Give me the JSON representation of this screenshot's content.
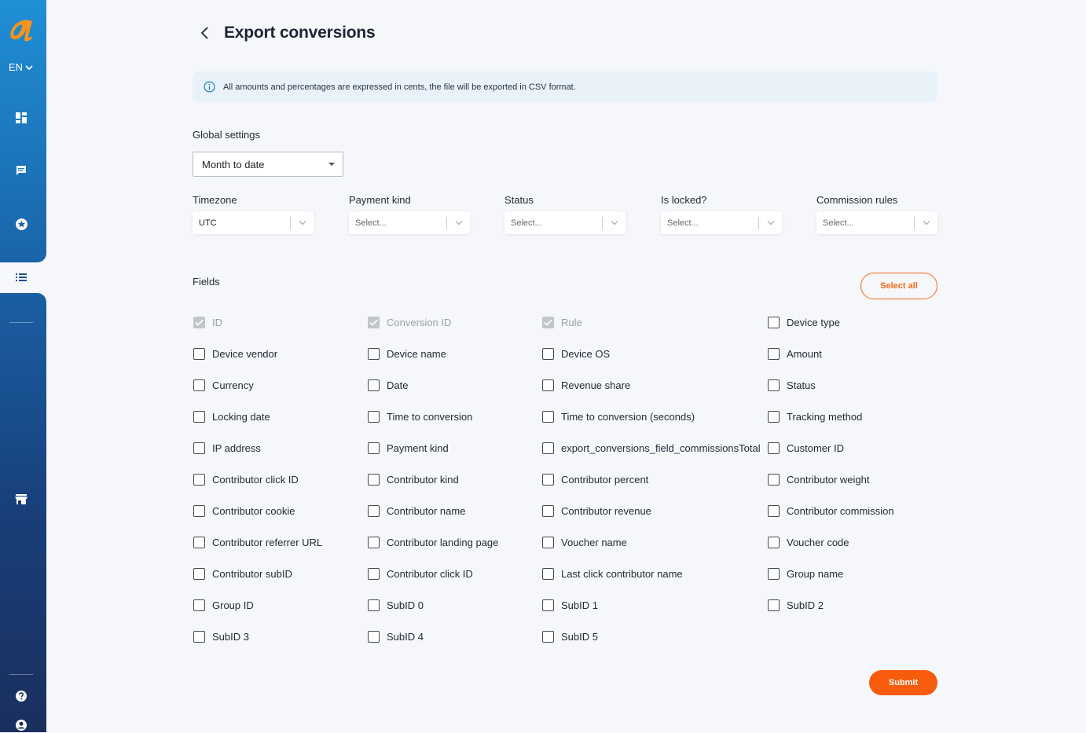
{
  "sidebar": {
    "lang": "EN",
    "brand_color": "#f7941d",
    "icons": [
      "dashboard-icon",
      "chat-icon",
      "star-badge-icon",
      "list-icon",
      "store-icon",
      "help-icon",
      "account-icon"
    ]
  },
  "header": {
    "title": "Export conversions"
  },
  "info": {
    "text": "All amounts and percentages are expressed in cents, the file will be exported in CSV format."
  },
  "global": {
    "label": "Global settings",
    "date_range": "Month to date"
  },
  "filters": [
    {
      "label": "Timezone",
      "value": "UTC"
    },
    {
      "label": "Payment kind",
      "value": "Select..."
    },
    {
      "label": "Status",
      "value": "Select..."
    },
    {
      "label": "Is locked?",
      "value": "Select..."
    },
    {
      "label": "Commission rules",
      "value": "Select..."
    }
  ],
  "fields_section": {
    "label": "Fields",
    "select_all": "Select all"
  },
  "fields": [
    [
      "ID",
      "Conversion ID",
      "Rule",
      "Device type"
    ],
    [
      "Device vendor",
      "Device name",
      "Device OS",
      "Amount"
    ],
    [
      "Currency",
      "Date",
      "Revenue share",
      "Status"
    ],
    [
      "Locking date",
      "Time to conversion",
      "Time to conversion (seconds)",
      "Tracking method"
    ],
    [
      "IP address",
      "Payment kind",
      "export_conversions_field_commissionsTotal",
      "Customer ID"
    ],
    [
      "Contributor click ID",
      "Contributor kind",
      "Contributor percent",
      "Contributor weight"
    ],
    [
      "Contributor cookie",
      "Contributor name",
      "Contributor revenue",
      "Contributor commission"
    ],
    [
      "Contributor referrer URL",
      "Contributor landing page",
      "Voucher name",
      "Voucher code"
    ],
    [
      "Contributor subID",
      "Contributor click ID",
      "Last click contributor name",
      "Group name"
    ],
    [
      "Group ID",
      "SubID 0",
      "SubID 1",
      "SubID 2"
    ],
    [
      "SubID 3",
      "SubID 4",
      "SubID 5",
      ""
    ]
  ],
  "locked_fields": [
    "ID",
    "Conversion ID",
    "Rule"
  ],
  "submit_label": "Submit",
  "accent_color": "#f75c0c"
}
